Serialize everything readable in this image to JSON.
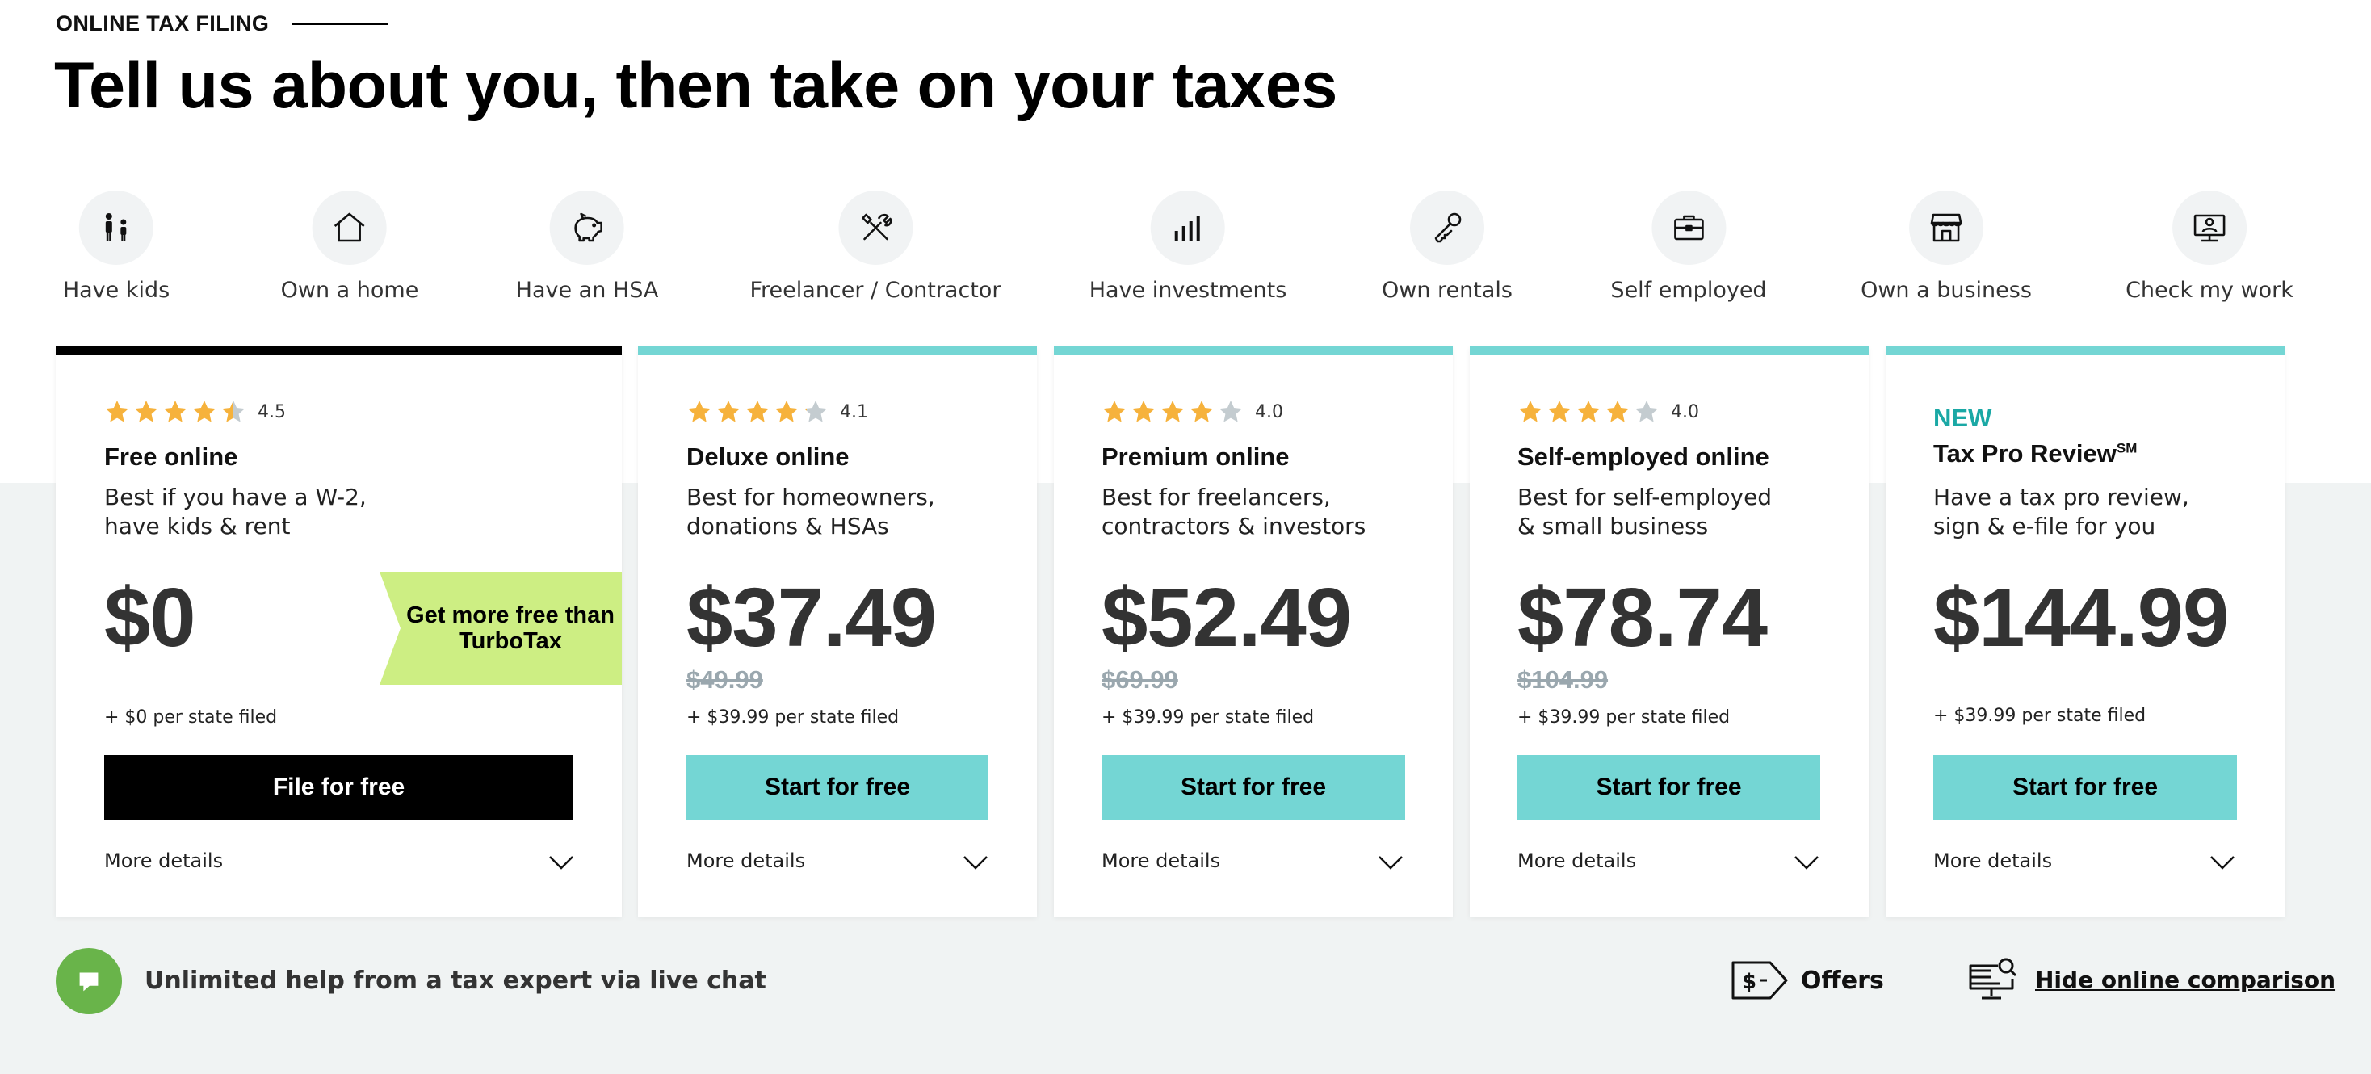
{
  "header": {
    "eyebrow": "ONLINE TAX FILING",
    "title": "Tell us about you, then take on your taxes"
  },
  "filters": [
    {
      "label": "Have kids",
      "icon": "kids-icon"
    },
    {
      "label": "Own a home",
      "icon": "home-icon"
    },
    {
      "label": "Have an HSA",
      "icon": "piggy-bank-icon"
    },
    {
      "label": "Freelancer / Contractor",
      "icon": "tools-icon"
    },
    {
      "label": "Have investments",
      "icon": "bar-chart-icon"
    },
    {
      "label": "Own rentals",
      "icon": "key-icon"
    },
    {
      "label": "Self employed",
      "icon": "briefcase-icon"
    },
    {
      "label": "Own a business",
      "icon": "storefront-icon"
    },
    {
      "label": "Check my work",
      "icon": "computer-user-icon"
    }
  ],
  "cards": [
    {
      "rating": 4.5,
      "rating_label": "4.5",
      "title": "Free online",
      "desc": "Best if you have a W-2, have kids & rent",
      "price": "$0",
      "state_fee": "+ $0  per state filed",
      "cta": "File for free",
      "more": "More details",
      "promo": "Get more free than TurboTax"
    },
    {
      "rating": 4.1,
      "rating_label": "4.1",
      "title": "Deluxe online",
      "desc": "Best for homeowners, donations & HSAs",
      "price": "$37.49",
      "was": "$49.99",
      "state_fee": "+ $39.99 per state filed",
      "cta": "Start for free",
      "more": "More details"
    },
    {
      "rating": 4.0,
      "rating_label": "4.0",
      "title": "Premium online",
      "desc": "Best for freelancers, contractors & investors",
      "price": "$52.49",
      "was": "$69.99",
      "state_fee": "+ $39.99 per state filed",
      "cta": "Start for free",
      "more": "More details"
    },
    {
      "rating": 4.0,
      "rating_label": "4.0",
      "title": "Self-employed online",
      "desc": "Best for self-employed & small business",
      "price": "$78.74",
      "was": "$104.99",
      "state_fee": "+ $39.99 per state filed",
      "cta": "Start for free",
      "more": "More details"
    },
    {
      "badge": "NEW",
      "title": "Tax Pro Review",
      "title_mark": "SM",
      "desc": "Have a tax pro review, sign & e-file for you",
      "price": "$144.99",
      "state_fee": "+ $39.99 per state filed",
      "cta": "Start for free",
      "more": "More details"
    }
  ],
  "footer": {
    "chat": "Unlimited help from a tax expert via live chat",
    "offers": "Offers",
    "hide": "Hide online comparison"
  },
  "colors": {
    "accent_teal": "#74d6d4",
    "star": "#f6b23c",
    "star_empty": "#c4ccd0",
    "promo": "#cdee83",
    "chat": "#69b44a"
  }
}
